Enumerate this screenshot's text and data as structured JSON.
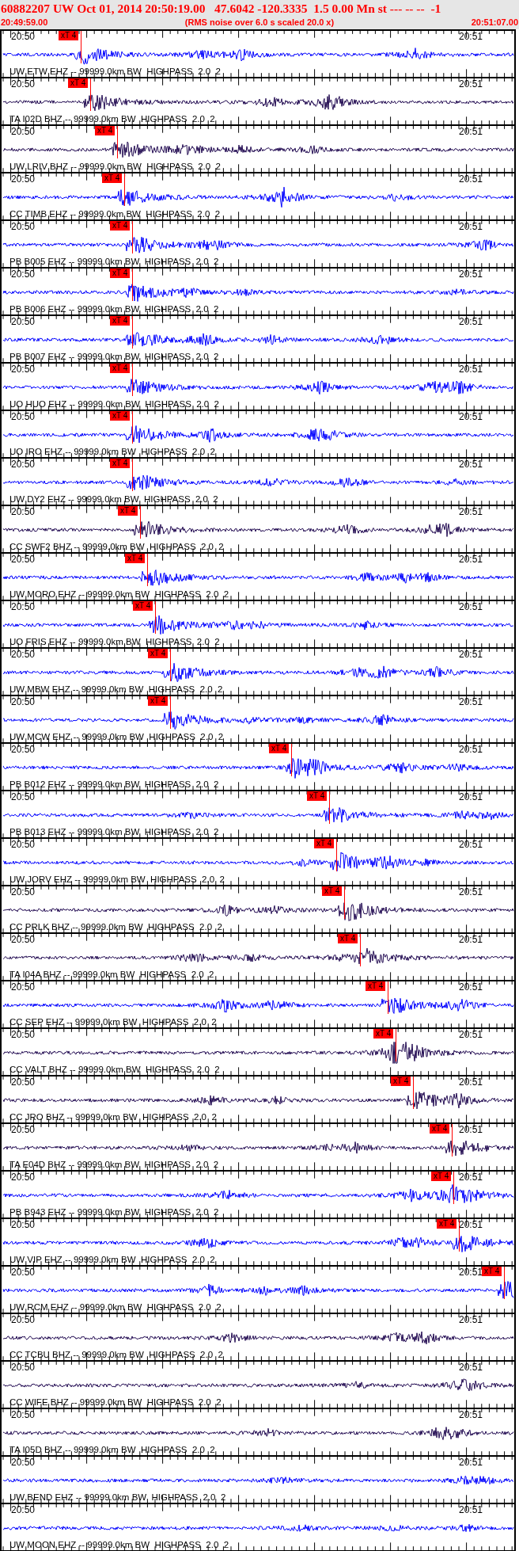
{
  "header": {
    "title": "60882207 UW Oct 01, 2014 20:50:19.00   47.6042 -120.3335  1.5 0.00 Mn st --- -- --  -1",
    "start_time": "20:49:59.00",
    "note": "(RMS noise over 6.0 s scaled 20.0 x)",
    "end_time": "20:51:07.00"
  },
  "traces": [
    {
      "start_label": "20:50",
      "end_label": "20:51",
      "pick": "xT 4",
      "channel": "UW ETW EHZ -- 99999.0km BW  HIGHPASS  2.0  2",
      "color": "#0000ff"
    },
    {
      "start_label": "20:50",
      "end_label": "20:51",
      "pick": "xT 4",
      "channel": "TA I02D BHZ -- 99999.0km BW  HIGHPASS  2.0  2",
      "color": "#200850"
    },
    {
      "start_label": "20:50",
      "end_label": "20:51",
      "pick": "xT 4",
      "channel": "UW LRIV BHZ -- 99999.0km BW  HIGHPASS  2.0  2",
      "color": "#200850"
    },
    {
      "start_label": "20:50",
      "end_label": "20:51",
      "pick": "xT 4",
      "channel": "CC TIMB EHZ -- 99999.0km BW  HIGHPASS  2.0  2",
      "color": "#0000ff"
    },
    {
      "start_label": "20:50",
      "end_label": "20:51",
      "pick": "xT 4",
      "channel": "PB B005 EHZ -- 99999.0km BW  HIGHPASS  2.0  2",
      "color": "#0000ff"
    },
    {
      "start_label": "20:50",
      "end_label": "20:51",
      "pick": "xT 4",
      "channel": "PB B006 EHZ -- 99999.0km BW  HIGHPASS  2.0  2",
      "color": "#0000ff"
    },
    {
      "start_label": "20:50",
      "end_label": "20:51",
      "pick": "xT 4",
      "channel": "PB B007 EHZ -- 99999.0km BW  HIGHPASS  2.0  2",
      "color": "#0000ff"
    },
    {
      "start_label": "20:50",
      "end_label": "20:51",
      "pick": "xT 4",
      "channel": "UO HUO EHZ -- 99999.0km BW  HIGHPASS  2.0  2",
      "color": "#0000ff"
    },
    {
      "start_label": "20:50",
      "end_label": "20:51",
      "pick": "xT 4",
      "channel": "UO IRO EHZ -- 99999.0km BW  HIGHPASS  2.0  2",
      "color": "#0000ff"
    },
    {
      "start_label": "20:50",
      "end_label": "20:51",
      "pick": "xT 4",
      "channel": "UW DY2 EHZ -- 99999.0km BW  HIGHPASS  2.0  2",
      "color": "#0000ff"
    },
    {
      "start_label": "20:50",
      "end_label": "20:51",
      "pick": "xT 4",
      "channel": "CC SWF2 BHZ -- 99999.0km BW  HIGHPASS  2.0  2",
      "color": "#200850"
    },
    {
      "start_label": "20:50",
      "end_label": "20:51",
      "pick": "xT 4",
      "channel": "UW MORO EHZ -- 99999.0km BW  HIGHPASS  2.0  2",
      "color": "#0000ff"
    },
    {
      "start_label": "20:50",
      "end_label": "20:51",
      "pick": "xT 4",
      "channel": "UO FRIS EHZ -- 99999.0km BW  HIGHPASS  2.0  2",
      "color": "#0000ff"
    },
    {
      "start_label": "20:50",
      "end_label": "20:51",
      "pick": "xT 4",
      "channel": "UW MBW EHZ -- 99999.0km BW  HIGHPASS  2.0  2",
      "color": "#0000ff"
    },
    {
      "start_label": "20:50",
      "end_label": "20:51",
      "pick": "xT 4",
      "channel": "UW MCW EHZ -- 99999.0km BW  HIGHPASS  2.0  2",
      "color": "#0000ff"
    },
    {
      "start_label": "20:50",
      "end_label": "20:51",
      "pick": "xT 4",
      "channel": "PB B012 EHZ -- 99999.0km BW  HIGHPASS  2.0  2",
      "color": "#0000ff"
    },
    {
      "start_label": "20:50",
      "end_label": "20:51",
      "pick": "xT 4",
      "channel": "PB B013 EHZ -- 99999.0km BW  HIGHPASS  2.0  2",
      "color": "#0000ff"
    },
    {
      "start_label": "20:50",
      "end_label": "20:51",
      "pick": "xT 4",
      "channel": "UW JORV EHZ -- 99999.0km BW  HIGHPASS  2.0  2",
      "color": "#0000ff"
    },
    {
      "start_label": "20:50",
      "end_label": "20:51",
      "pick": "xT 4",
      "channel": "CC PRLK BHZ -- 99999.0km BW  HIGHPASS  2.0  2",
      "color": "#200850"
    },
    {
      "start_label": "20:50",
      "end_label": "20:51",
      "pick": "xT 4",
      "channel": "TA I04A BHZ -- 99999.0km BW  HIGHPASS  2.0  2",
      "color": "#200850"
    },
    {
      "start_label": "20:50",
      "end_label": "20:51",
      "pick": "xT 4",
      "channel": "CC SEP EHZ -- 99999.0km BW  HIGHPASS  2.0  2",
      "color": "#0000ff"
    },
    {
      "start_label": "20:50",
      "end_label": "20:51",
      "pick": "xT 4",
      "channel": "CC VALT BHZ -- 99999.0km BW  HIGHPASS  2.0  2",
      "color": "#200850"
    },
    {
      "start_label": "20:50",
      "end_label": "20:51",
      "pick": "xT 4",
      "channel": "CC JRO BHZ -- 99999.0km BW  HIGHPASS  2.0  2",
      "color": "#200850"
    },
    {
      "start_label": "20:50",
      "end_label": "20:51",
      "pick": "xT 4",
      "channel": "TA E04D BHZ -- 99999.0km BW  HIGHPASS  2.0  2",
      "color": "#200850"
    },
    {
      "start_label": "20:50",
      "end_label": "20:51",
      "pick": "xT 4",
      "channel": "PB B943 EHZ -- 99999.0km BW  HIGHPASS  2.0  2",
      "color": "#0000ff"
    },
    {
      "start_label": "20:50",
      "end_label": "20:51",
      "pick": "xT 4",
      "channel": "UW VIP EHZ -- 99999.0km BW  HIGHPASS  2.0  2",
      "color": "#0000ff"
    },
    {
      "start_label": "20:50",
      "end_label": "20:51",
      "pick": "xT 4",
      "channel": "UW RCM EHZ -- 99999.0km BW  HIGHPASS  2.0  2",
      "color": "#0000ff"
    },
    {
      "start_label": "20:50",
      "end_label": "20:51",
      "channel": "CC TCBU BHZ -- 99999.0km BW  HIGHPASS  2.0  2",
      "color": "#200850"
    },
    {
      "start_label": "20:50",
      "end_label": "20:51",
      "channel": "CC WIFE BHZ -- 99999.0km BW  HIGHPASS  2.0  2",
      "color": "#200850"
    },
    {
      "start_label": "20:50",
      "end_label": "20:51",
      "channel": "TA I05D BHZ -- 99999.0km BW  HIGHPASS  2.0  2",
      "color": "#200850"
    },
    {
      "start_label": "20:50",
      "end_label": "20:51",
      "channel": "UW BEND EHZ -- 99999.0km BW  HIGHPASS  2.0  2",
      "color": "#0000ff"
    },
    {
      "start_label": "20:50",
      "end_label": "20:51",
      "channel": "UW MOON EHZ -- 99999.0km BW  HIGHPASS  2.0  2",
      "color": "#0000ff"
    }
  ]
}
